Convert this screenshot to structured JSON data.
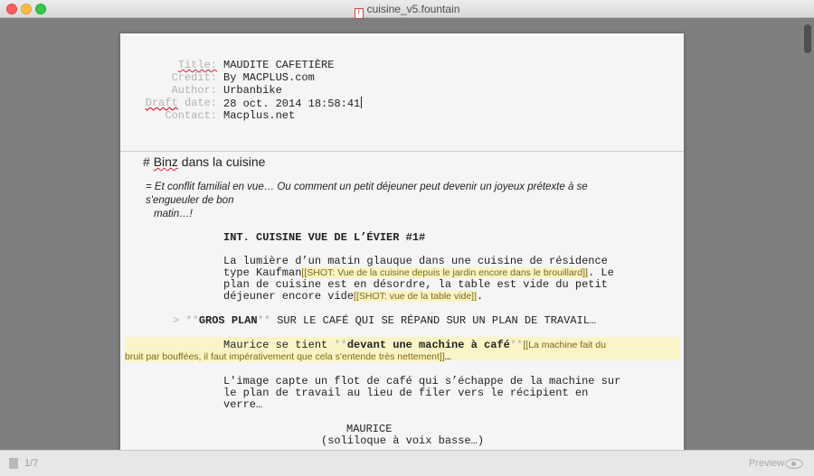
{
  "window": {
    "title": "cuisine_v5.fountain",
    "doc_icon": "fountain-document-icon"
  },
  "title_page": {
    "title_label": "Title:",
    "title_value": "MAUDITE CAFETIÈRE",
    "credit_label": "Credit:",
    "credit_value": "By MACPLUS.com",
    "author_label": "Author:",
    "author_value": "Urbanbike",
    "draft_label": "Draft date:",
    "draft_value": "28 oct. 2014 18:58:41",
    "contact_label": "Contact:",
    "contact_value": "Macplus.net"
  },
  "script": {
    "section_prefix": "# ",
    "section_word": "Binz",
    "section_rest": " dans la cuisine",
    "synopsis_l1": "= Et conflit familial en vue… Ou comment un petit déjeuner peut devenir un joyeux prétexte à se s'engueuler de bon",
    "synopsis_l2": "matin…!",
    "scene_heading": "INT. CUISINE VUE DE L’ÉVIER #1#",
    "action1_l1": "La lumière d’un matin glauque dans une cuisine de résidence",
    "action1_l2a": "type Kaufman",
    "note1": "[[SHOT: Vue de la cuisine depuis le jardin encore dans le brouillard]]",
    "action1_l2b": ". Le",
    "action1_l3": "plan de cuisine est en désordre, la table est vide du petit",
    "action1_l4a": "déjeuner encore vide",
    "note2": "[[SHOT: vue de la table vide]]",
    "action1_l4b": ".",
    "forced_prefix": "> ",
    "forced_stars_open": "**",
    "forced_bold": "GROS PLAN",
    "forced_stars_close": "**",
    "forced_rest": " SUR LE CAFÉ QUI SE RÉPAND SUR UN PLAN DE TRAVAIL…",
    "action2_a": "Maurice se tient ",
    "action2_stars_open": "**",
    "action2_bold": "devant une machine à café",
    "action2_stars_close": "**",
    "note3_l1": "[[La machine fait du",
    "note3_l2": "bruit par bouffées, il faut impérativement que cela s'entende très nettement]]",
    "action2_end": "…",
    "action3_l1": "L'image capte un flot de café qui s’échappe de la machine sur",
    "action3_l2": "le plan de travail au lieu de filer vers le récipient en",
    "action3_l3": "verre…",
    "character": "MAURICE",
    "parenthetical": "(soliloque à voix basse…)"
  },
  "footer": {
    "page_count": "1/7",
    "preview_label": "Preview"
  }
}
